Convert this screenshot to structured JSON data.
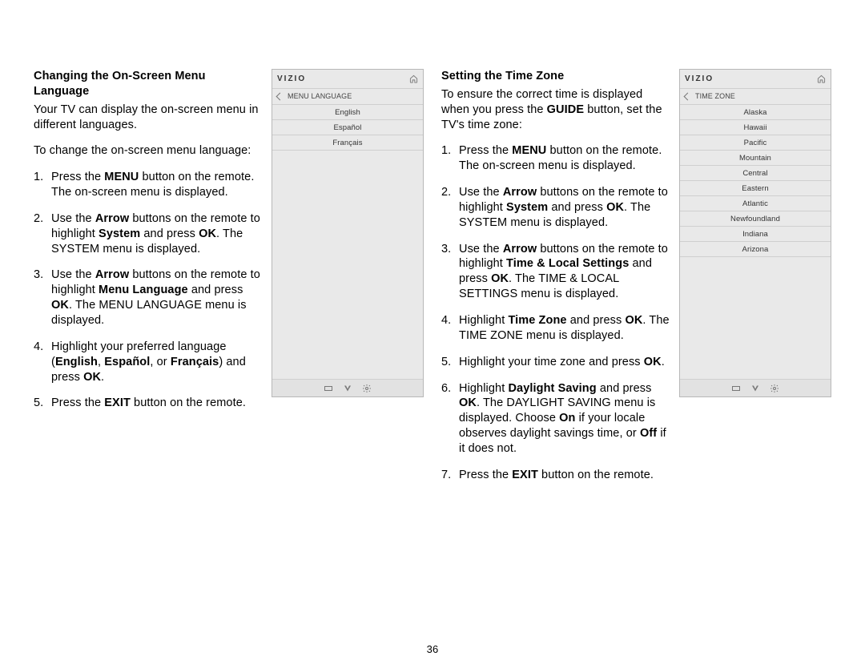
{
  "page_number": "36",
  "left": {
    "heading": "Changing the On-Screen Menu Language",
    "intro1": "Your TV can display the on-screen menu in different languages.",
    "intro2": "To change the on-screen menu language:",
    "step1_a": "Press the ",
    "step1_b": "MENU",
    "step1_c": " button on the remote. The on-screen menu is displayed.",
    "step2_a": "Use the ",
    "step2_b": "Arrow",
    "step2_c": " buttons on the remote to highlight ",
    "step2_d": "System",
    "step2_e": " and press ",
    "step2_f": "OK",
    "step2_g": ". The SYSTEM menu is displayed.",
    "step3_a": "Use the ",
    "step3_b": "Arrow",
    "step3_c": " buttons on the remote to highlight ",
    "step3_d": "Menu Language",
    "step3_e": " and press ",
    "step3_f": "OK",
    "step3_g": ". The MENU LANGUAGE menu is displayed.",
    "step4_a": "Highlight your preferred language (",
    "step4_b": "English",
    "step4_c": ", ",
    "step4_d": "Español",
    "step4_e": ", or ",
    "step4_f": "Français",
    "step4_g": ") and press ",
    "step4_h": "OK",
    "step4_i": ".",
    "step5_a": "Press the ",
    "step5_b": "EXIT",
    "step5_c": " button on the remote.",
    "osd": {
      "brand": "VIZIO",
      "title": "MENU LANGUAGE",
      "rows": [
        "English",
        "Español",
        "Français"
      ]
    }
  },
  "right": {
    "heading": "Setting the Time Zone",
    "intro1_a": "To ensure the correct time is displayed when you press the ",
    "intro1_b": "GUIDE",
    "intro1_c": " button, set the TV's time zone:",
    "step1_a": "Press the ",
    "step1_b": "MENU",
    "step1_c": " button on the remote. The on-screen menu is displayed.",
    "step2_a": "Use the ",
    "step2_b": "Arrow",
    "step2_c": " buttons on the remote to highlight ",
    "step2_d": "System",
    "step2_e": " and press ",
    "step2_f": "OK",
    "step2_g": ". The SYSTEM menu is displayed.",
    "step3_a": "Use the ",
    "step3_b": "Arrow",
    "step3_c": " buttons on the remote to highlight ",
    "step3_d": "Time & Local Settings",
    "step3_e": " and press ",
    "step3_f": "OK",
    "step3_g": ". The TIME & LOCAL SETTINGS menu is displayed.",
    "step4_a": "Highlight ",
    "step4_b": "Time Zone",
    "step4_c": " and press ",
    "step4_d": "OK",
    "step4_e": ". The TIME ZONE menu is displayed.",
    "step5_a": "Highlight your time zone and press ",
    "step5_b": "OK",
    "step5_c": ".",
    "step6_a": "Highlight ",
    "step6_b": "Daylight Saving",
    "step6_c": " and press ",
    "step6_d": "OK",
    "step6_e": ". The DAYLIGHT SAVING menu is displayed. Choose ",
    "step6_f": "On",
    "step6_g": " if your locale observes daylight savings time, or ",
    "step6_h": "Off",
    "step6_i": " if it does not.",
    "step7_a": "Press the ",
    "step7_b": "EXIT",
    "step7_c": " button on the remote.",
    "osd": {
      "brand": "VIZIO",
      "title": "TIME ZONE",
      "rows": [
        "Alaska",
        "Hawaii",
        "Pacific",
        "Mountain",
        "Central",
        "Eastern",
        "Atlantic",
        "Newfoundland",
        "Indiana",
        "Arizona"
      ]
    }
  }
}
